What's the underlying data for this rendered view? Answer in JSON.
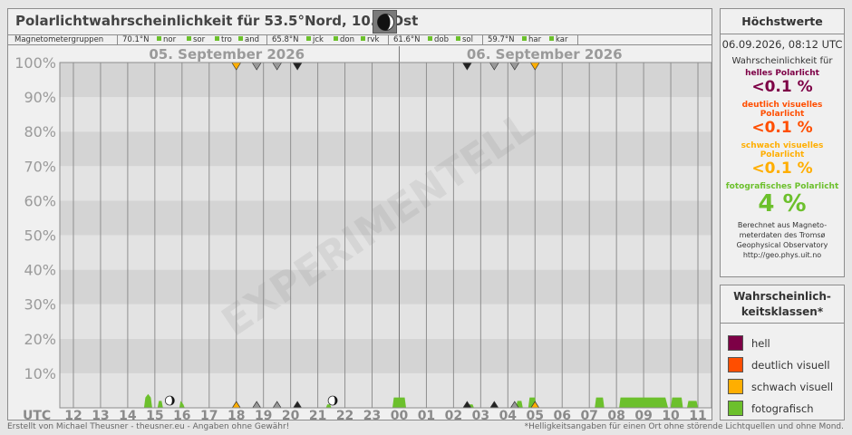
{
  "title": "Polarlichtwahrscheinlichkeit für 53.5°Nord, 10.0°Ost",
  "magnetometer": {
    "label": "Magnetometergruppen",
    "groups": [
      {
        "lat": "70.1°N",
        "stations": [
          "nor",
          "sor",
          "tro",
          "and"
        ]
      },
      {
        "lat": "65.8°N",
        "stations": [
          "jck",
          "don",
          "rvk"
        ]
      },
      {
        "lat": "61.6°N",
        "stations": [
          "dob",
          "sol"
        ]
      },
      {
        "lat": "59.7°N",
        "stations": [
          "har",
          "kar"
        ]
      }
    ]
  },
  "colors": {
    "hell": "#7d0046",
    "deutlich": "#ff4e00",
    "schwach": "#ffae00",
    "fotografisch": "#6cc02c",
    "marker_gray": "#999999",
    "marker_dark": "#222222"
  },
  "chart_data": {
    "type": "area",
    "watermark": "EXPERIMENTELL",
    "date_labels": [
      "05. September 2026",
      "06. September 2026"
    ],
    "x_axis_prefix": "UTC",
    "x_ticks": [
      "12",
      "13",
      "14",
      "15",
      "16",
      "17",
      "18",
      "19",
      "20",
      "21",
      "22",
      "23",
      "00",
      "01",
      "02",
      "03",
      "04",
      "05",
      "06",
      "07",
      "08",
      "09",
      "10",
      "11"
    ],
    "y_ticks": [
      "10%",
      "20%",
      "30%",
      "40%",
      "50%",
      "60%",
      "70%",
      "80%",
      "90%",
      "100%"
    ],
    "ylim": [
      0,
      100
    ],
    "xlim_hours": [
      11.5,
      35.5
    ],
    "grid": true,
    "series": [
      {
        "name": "fotografisch",
        "color": "#6cc02c",
        "points": [
          [
            14.6,
            0
          ],
          [
            14.65,
            3
          ],
          [
            14.75,
            4
          ],
          [
            14.85,
            3
          ],
          [
            14.9,
            0
          ],
          [
            15.1,
            0
          ],
          [
            15.15,
            2
          ],
          [
            15.25,
            2
          ],
          [
            15.3,
            0
          ],
          [
            15.9,
            0
          ],
          [
            15.95,
            2
          ],
          [
            16.05,
            1
          ],
          [
            16.1,
            0
          ],
          [
            21.3,
            0
          ],
          [
            21.35,
            1
          ],
          [
            21.45,
            1
          ],
          [
            21.5,
            0
          ],
          [
            23.75,
            0
          ],
          [
            23.8,
            3
          ],
          [
            24.2,
            3
          ],
          [
            24.25,
            0
          ],
          [
            26.45,
            0
          ],
          [
            26.5,
            1
          ],
          [
            26.7,
            1
          ],
          [
            26.75,
            0
          ],
          [
            28.3,
            0
          ],
          [
            28.35,
            2
          ],
          [
            28.5,
            2
          ],
          [
            28.55,
            0
          ],
          [
            28.75,
            0
          ],
          [
            28.8,
            3
          ],
          [
            29.0,
            3
          ],
          [
            29.05,
            0
          ],
          [
            31.2,
            0
          ],
          [
            31.25,
            3
          ],
          [
            31.5,
            3
          ],
          [
            31.55,
            0
          ],
          [
            32.1,
            0
          ],
          [
            32.15,
            3
          ],
          [
            33.8,
            3
          ],
          [
            33.9,
            0
          ],
          [
            34.0,
            0
          ],
          [
            34.05,
            3
          ],
          [
            34.4,
            3
          ],
          [
            34.45,
            0
          ],
          [
            34.6,
            0
          ],
          [
            34.65,
            2
          ],
          [
            34.95,
            2
          ],
          [
            35.0,
            0
          ]
        ]
      }
    ],
    "kp_markers": [
      {
        "hour": 18.0,
        "class": "schwach"
      },
      {
        "hour": 18.75,
        "class": "gray"
      },
      {
        "hour": 19.5,
        "class": "gray"
      },
      {
        "hour": 20.25,
        "class": "dark"
      },
      {
        "hour": 26.5,
        "class": "dark"
      },
      {
        "hour": 27.5,
        "class": "gray"
      },
      {
        "hour": 28.25,
        "class": "gray"
      },
      {
        "hour": 29.0,
        "class": "schwach"
      }
    ],
    "bottom_markers": [
      {
        "hour": 18.0,
        "class": "schwach"
      },
      {
        "hour": 18.75,
        "class": "gray"
      },
      {
        "hour": 19.5,
        "class": "gray"
      },
      {
        "hour": 20.25,
        "class": "dark"
      },
      {
        "hour": 26.5,
        "class": "dark"
      },
      {
        "hour": 27.5,
        "class": "dark"
      },
      {
        "hour": 28.25,
        "class": "gray"
      },
      {
        "hour": 29.0,
        "class": "schwach"
      }
    ],
    "moon_markers": [
      15.55,
      21.55
    ]
  },
  "sidebar": {
    "heading": "Höchstwerte",
    "datetime": "06.09.2026, 08:12 UTC",
    "intro": "Wahrscheinlichkeit für",
    "levels": [
      {
        "label": "helles Polarlicht",
        "value": "<0.1 %"
      },
      {
        "label": "deutlich visuelles Polarlicht",
        "value": "<0.1 %"
      },
      {
        "label": "schwach visuelles Polarlicht",
        "value": "<0.1 %"
      },
      {
        "label": "fotografisches Polarlicht",
        "value": "4 %"
      }
    ],
    "note_lines": [
      "Berechnet aus Magneto-",
      "meterdaten des Tromsø",
      "Geophysical Observatory",
      "http://geo.phys.uit.no"
    ]
  },
  "legend": {
    "heading_lines": [
      "Wahrscheinlich-",
      "keitsklassen*"
    ],
    "items": [
      {
        "label": "hell",
        "color": "#7d0046"
      },
      {
        "label": "deutlich visuell",
        "color": "#ff4e00"
      },
      {
        "label": "schwach visuell",
        "color": "#ffae00"
      },
      {
        "label": "fotografisch",
        "color": "#6cc02c"
      }
    ]
  },
  "footer": {
    "left": "Erstellt von Michael Theusner - theusner.eu - Angaben ohne Gewähr!",
    "right": "*Helligkeitsangaben für einen Ort ohne störende Lichtquellen und ohne Mond."
  }
}
